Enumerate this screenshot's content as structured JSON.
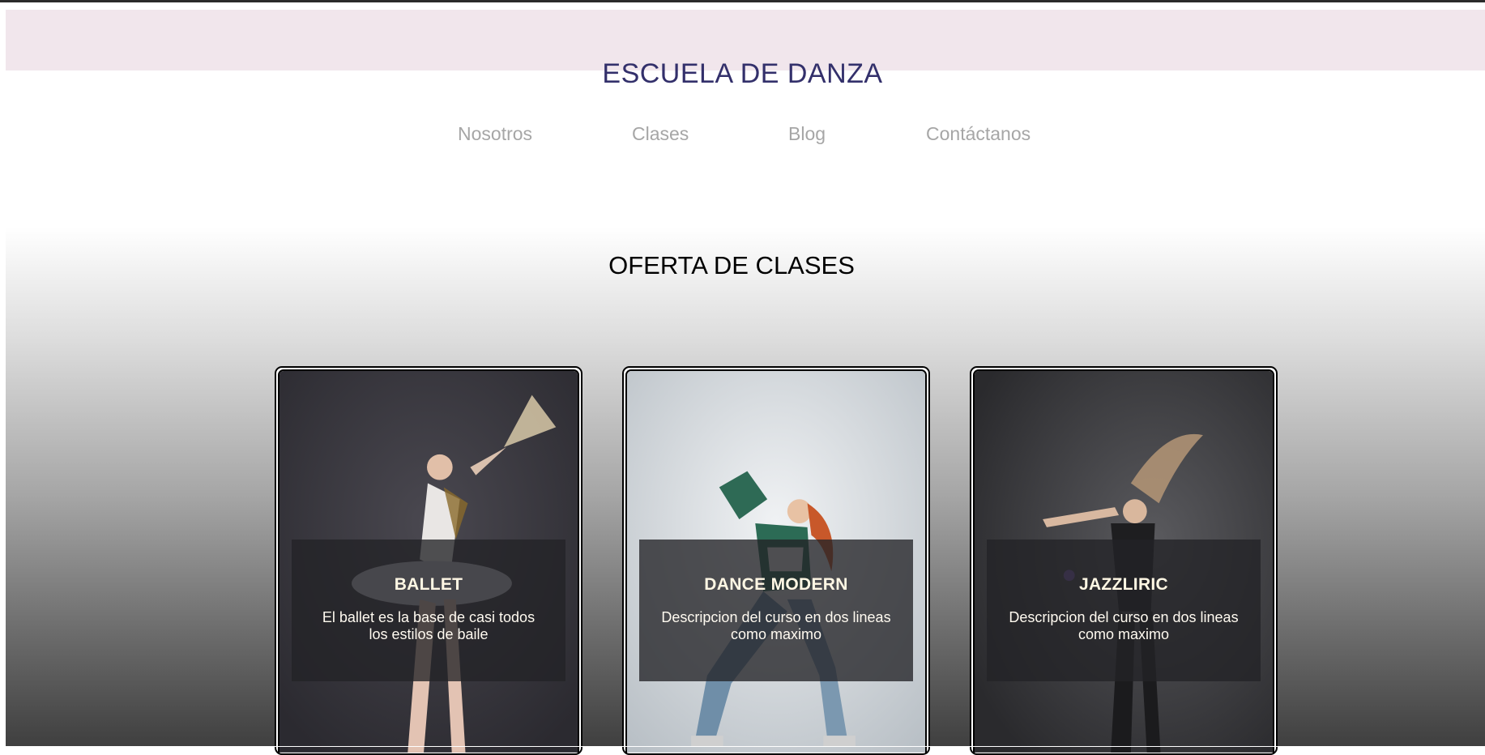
{
  "site": {
    "title": "ESCUELA DE DANZA"
  },
  "nav": {
    "items": [
      "Nosotros",
      "Clases",
      "Blog",
      "Contáctanos"
    ]
  },
  "offer": {
    "title": "OFERTA DE CLASES",
    "cards": [
      {
        "title": "BALLET",
        "description": "El ballet es la base de casi todos los estilos de baile"
      },
      {
        "title": "DANCE MODERN",
        "description": "Descripcion del curso en dos lineas como maximo"
      },
      {
        "title": "JAZZLIRIC",
        "description": "Descripcion del curso en dos lineas como maximo"
      }
    ]
  },
  "colors": {
    "header_band": "#f1e6ec",
    "title": "#33306b",
    "nav_text": "#a6a6a6",
    "card_overlay": "#232326"
  }
}
